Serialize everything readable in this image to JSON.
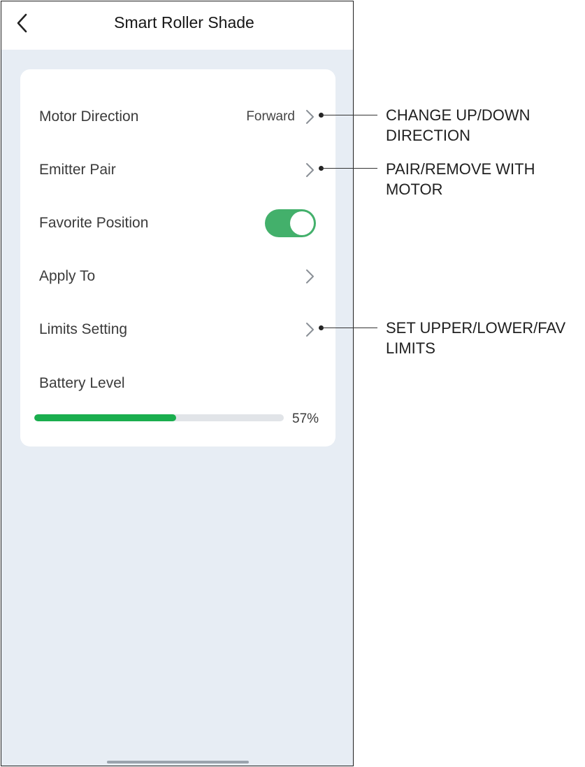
{
  "header": {
    "back_icon": "chevron-left-icon",
    "title": "Smart Roller Shade"
  },
  "settings": {
    "motor_direction": {
      "label": "Motor Direction",
      "value": "Forward"
    },
    "emitter_pair": {
      "label": "Emitter Pair"
    },
    "favorite_position": {
      "label": "Favorite Position",
      "enabled": true
    },
    "apply_to": {
      "label": "Apply To"
    },
    "limits_setting": {
      "label": "Limits Setting"
    },
    "battery": {
      "label": "Battery Level",
      "level_percent": 57,
      "value_text": "57%"
    }
  },
  "callouts": {
    "motor_direction": "CHANGE UP/DOWN\nDIRECTION",
    "emitter_pair": "PAIR/REMOVE WITH\nMOTOR",
    "limits_setting": "SET UPPER/LOWER/FAV\nLIMITS"
  },
  "colors": {
    "toggle_on": "#43b06b",
    "battery_fill": "#1aae4e",
    "screen_bg": "#e7edf4"
  }
}
